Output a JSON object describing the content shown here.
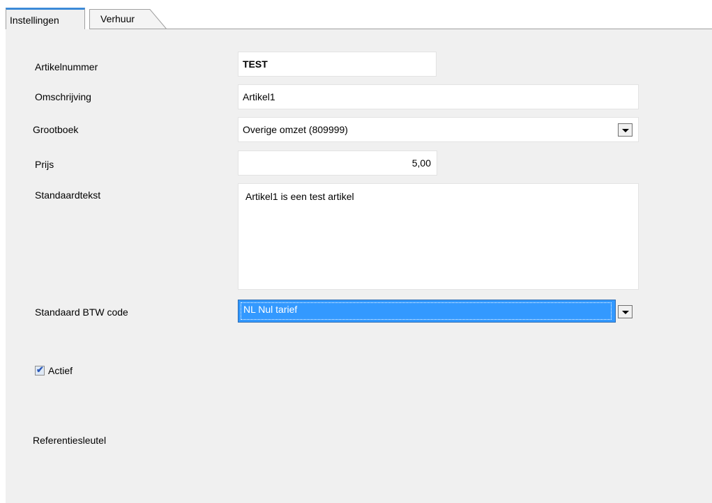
{
  "tabs": [
    {
      "label": "Instellingen"
    },
    {
      "label": "Verhuur"
    }
  ],
  "form": {
    "artikelnummer": {
      "label": "Artikelnummer",
      "value": "TEST"
    },
    "omschrijving": {
      "label": "Omschrijving",
      "value": "Artikel1"
    },
    "grootboek": {
      "label": "Grootboek",
      "value": "Overige omzet (809999)"
    },
    "prijs": {
      "label": "Prijs",
      "value": "5,00"
    },
    "standaardtekst": {
      "label": "Standaardtekst",
      "value": "Artikel1 is een test artikel"
    },
    "btw": {
      "label": "Standaard BTW code",
      "value": "NL Nul tarief"
    },
    "actief": {
      "label": "Actief",
      "checked": true
    },
    "referentiesleutel": {
      "label": "Referentiesleutel"
    }
  },
  "icons": {
    "dropdown": "chevron-down-icon",
    "check": "checkmark-icon"
  },
  "colors": {
    "selection": "#3399ff",
    "tab_accent": "#3c8ad8",
    "panel_bg": "#f0f0f0"
  }
}
